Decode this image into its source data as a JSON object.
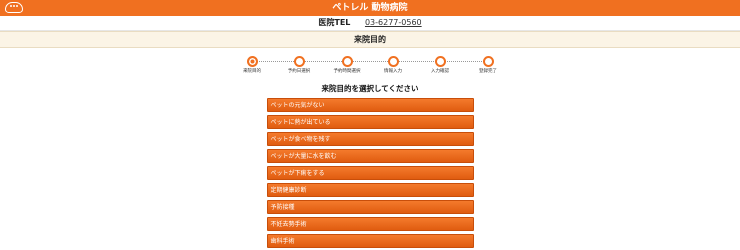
{
  "header": {
    "title": "ペトレル 動物病院",
    "logo_icon": "cloud-icon"
  },
  "contact": {
    "label": "医院TEL",
    "number": "03-6277-0560"
  },
  "section": {
    "title": "来院目的"
  },
  "steps": [
    {
      "label": "来院目的",
      "active": true
    },
    {
      "label": "予約日選択",
      "active": false
    },
    {
      "label": "予約時間選択",
      "active": false
    },
    {
      "label": "情報入力",
      "active": false
    },
    {
      "label": "入力確認",
      "active": false
    },
    {
      "label": "登録完了",
      "active": false
    }
  ],
  "prompt": "来院目的を選択してください",
  "purposes": [
    "ペットの元気がない",
    "ペットに熱が出ている",
    "ペットが食べ物を残す",
    "ペットが大量に水を飲む",
    "ペットが下痢をする",
    "定期健康診断",
    "予防接種",
    "不妊去勢手術",
    "歯科手術"
  ],
  "colors": {
    "accent": "#f07020",
    "section_bg": "#fbf4e6"
  }
}
